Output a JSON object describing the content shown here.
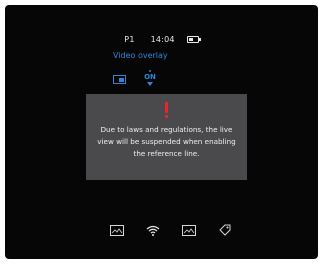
{
  "status_bar": {
    "profile": "P1",
    "time": "14:04",
    "battery_level": 0.6
  },
  "overlay": {
    "title": "Video overlay",
    "on_label": "ON"
  },
  "dialog": {
    "message": "Due to laws and regulations, the live view will be suspended when enabling the reference line."
  },
  "icons": {
    "status": [
      "battery-icon"
    ],
    "overlay": [
      "monitor-icon",
      "on-toggle-icon"
    ],
    "bottom": [
      "image-frame-icon",
      "wifi-icon",
      "image-frame-icon",
      "tag-icon"
    ]
  },
  "colors": {
    "background": "#060607",
    "accent": "#2f86d6",
    "dialog": "#4a4a4c",
    "warning": "#e8262e",
    "text": "#f0f0f0"
  }
}
